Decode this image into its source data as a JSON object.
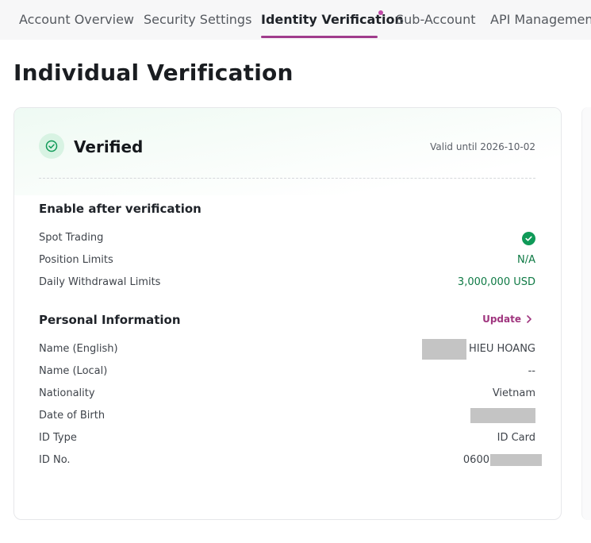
{
  "tabs": [
    {
      "label": "Account Overview"
    },
    {
      "label": "Security Settings"
    },
    {
      "label": "Identity Verification"
    },
    {
      "label": "Sub-Account"
    },
    {
      "label": "API Management"
    }
  ],
  "active_tab": "Identity Verification",
  "page_title": "Individual Verification",
  "status": {
    "label": "Verified",
    "valid_until": "Valid until 2026-10-02",
    "icon": "check-circle-icon",
    "color": "#0f9a58"
  },
  "enable_section": {
    "title": "Enable after verification",
    "rows": [
      {
        "label": "Spot Trading",
        "value": "",
        "icon": "check-circle-icon"
      },
      {
        "label": "Position Limits",
        "value": "N/A"
      },
      {
        "label": "Daily Withdrawal Limits",
        "value": "3,000,000 USD"
      }
    ]
  },
  "personal_section": {
    "title": "Personal Information",
    "update_label": "Update",
    "rows": [
      {
        "label": "Name (English)",
        "value": "HIEU HOANG",
        "redacted": true
      },
      {
        "label": "Name (Local)",
        "value": "--"
      },
      {
        "label": "Nationality",
        "value": "Vietnam"
      },
      {
        "label": "Date of Birth",
        "value": "",
        "redacted": true
      },
      {
        "label": "ID Type",
        "value": "ID Card"
      },
      {
        "label": "ID No.",
        "value": "0600",
        "redacted": true
      }
    ]
  },
  "colors": {
    "accent": "#a03c8c",
    "green": "#0f7a45",
    "redaction": "#c4c4c4"
  }
}
